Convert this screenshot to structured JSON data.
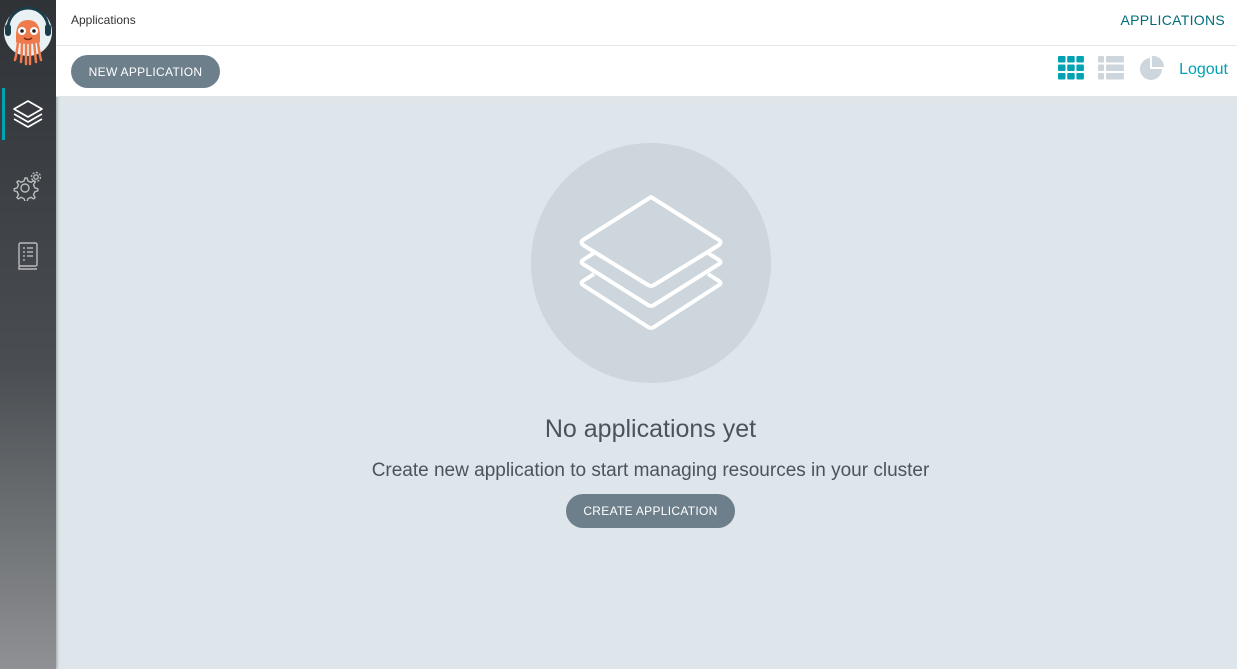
{
  "header": {
    "breadcrumb": "Applications",
    "title": "APPLICATIONS"
  },
  "toolbar": {
    "new_application_label": "NEW APPLICATION",
    "logout_label": "Logout",
    "view_icons": [
      "tiles-view-icon",
      "list-view-icon",
      "summary-view-icon"
    ]
  },
  "sidebar": {
    "items": [
      {
        "name": "applications",
        "icon": "layers-icon",
        "active": true
      },
      {
        "name": "settings",
        "icon": "gear-icon",
        "active": false
      },
      {
        "name": "user-info",
        "icon": "docs-icon",
        "active": false
      }
    ]
  },
  "empty_state": {
    "icon": "layers-icon",
    "title": "No applications yet",
    "subtitle": "Create new application to start managing resources in your cluster",
    "create_label": "CREATE APPLICATION"
  },
  "colors": {
    "accent": "#00a2b3",
    "title_accent": "#006d7a",
    "button": "#6d7f8b",
    "background": "#dee6eb"
  }
}
